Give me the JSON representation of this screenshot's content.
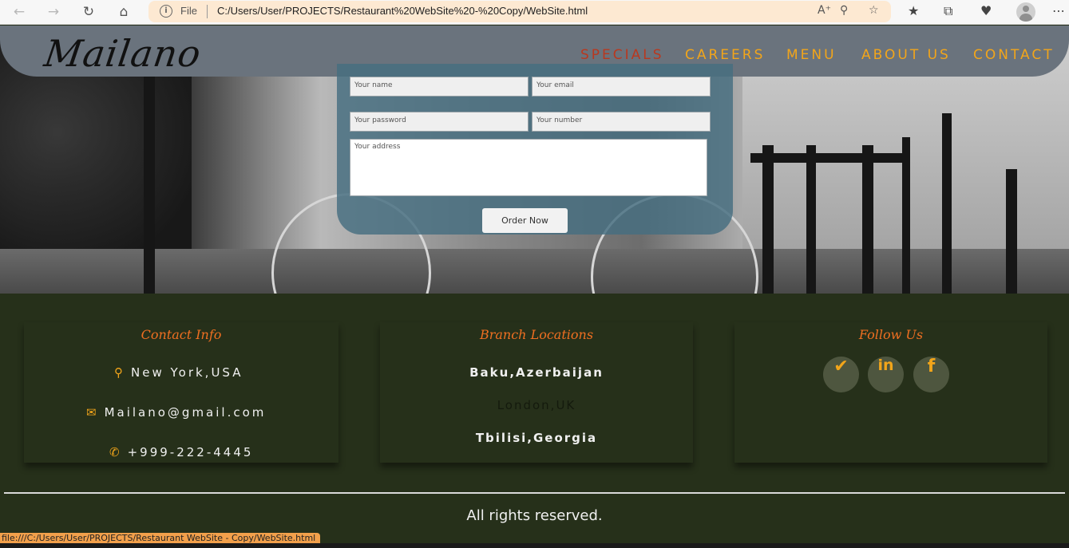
{
  "browser": {
    "protocol_label": "File",
    "url": "C:/Users/User/PROJECTS/Restaurant%20WebSite%20-%20Copy/WebSite.html",
    "status_url": "file:///C:/Users/User/PROJECTS/Restaurant WebSite - Copy/WebSite.html"
  },
  "header": {
    "logo": "Mailano",
    "nav": [
      "SPECIALS",
      "CAREERS",
      "MENU",
      "ABOUT US",
      "CONTACT"
    ],
    "active_nav": "SPECIALS"
  },
  "order_form": {
    "name_placeholder": "Your name",
    "email_placeholder": "Your email",
    "password_placeholder": "Your password",
    "number_placeholder": "Your number",
    "address_placeholder": "Your address",
    "submit_label": "Order Now"
  },
  "footer": {
    "contact": {
      "title": "Contact Info",
      "location": "New York,USA",
      "email": "Mailano@gmail.com",
      "phone": "+999-222-4445"
    },
    "branches": {
      "title": "Branch Locations",
      "items": [
        "Baku,Azerbaijan",
        "London,UK",
        "Tbilisi,Georgia"
      ]
    },
    "follow": {
      "title": "Follow Us",
      "networks": [
        "twitter-icon",
        "linkedin-icon",
        "facebook-icon"
      ]
    },
    "rights": "All rights reserved."
  },
  "colors": {
    "accent": "#f2a51a",
    "active_nav": "#b9381f",
    "footer_bg": "#26301a",
    "title_orange": "#ef6f21",
    "header_bg": "#6a737d"
  }
}
